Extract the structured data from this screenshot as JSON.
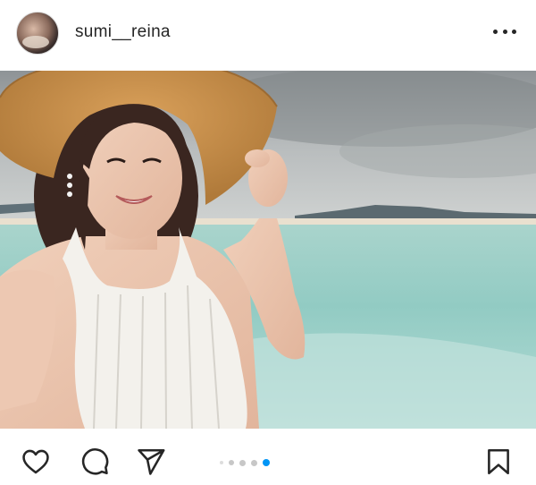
{
  "post": {
    "username": "sumi__reina",
    "avatar_icon": "profile-photo",
    "more_icon": "more-horizontal-icon"
  },
  "media": {
    "description_icon": "beach-selfie-photo"
  },
  "actions": {
    "like_icon": "heart-icon",
    "comment_icon": "comment-icon",
    "share_icon": "paper-plane-icon",
    "save_icon": "bookmark-icon"
  },
  "carousel": {
    "total": 5,
    "active_index": 4,
    "active_color": "#0095f6",
    "inactive_color": "#c7c7c7"
  }
}
